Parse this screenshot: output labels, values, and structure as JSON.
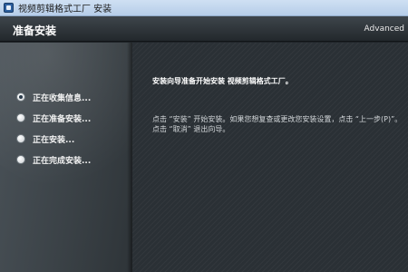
{
  "window": {
    "title": "视频剪辑格式工厂 安装"
  },
  "header": {
    "title": "准备安装",
    "advanced_label": "Advanced"
  },
  "steps": [
    {
      "label": "正在收集信息...",
      "checked": true
    },
    {
      "label": "正在准备安装...",
      "checked": false
    },
    {
      "label": "正在安装...",
      "checked": false
    },
    {
      "label": "正在完成安装...",
      "checked": false
    }
  ],
  "main": {
    "intro": "安装向导准备开始安装 视频剪辑格式工厂。",
    "instructions": "点击 “安装” 开始安装。如果您想复查或更改您安装设置，点击 “上一步(P)”。点击 “取消” 退出向导。"
  },
  "icons": {
    "app": "installer-app-icon",
    "step_marker": "radio-icon"
  }
}
